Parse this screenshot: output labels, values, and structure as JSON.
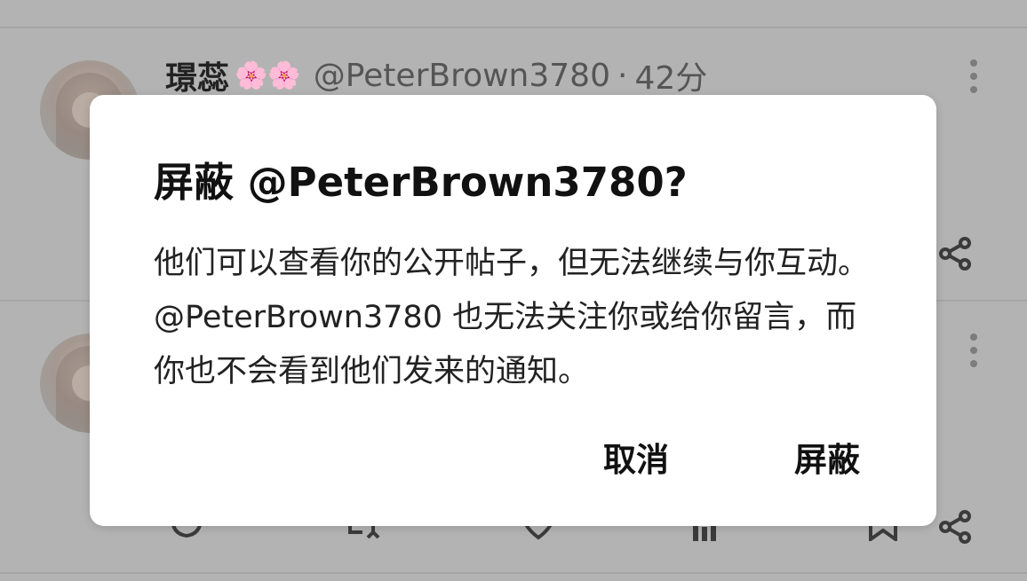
{
  "feed": {
    "tweet": {
      "display_name": "璟蕊",
      "emojis": "🌸🌸",
      "handle": "@PeterBrown3780",
      "separator": "·",
      "time": "42分"
    }
  },
  "dialog": {
    "title": "屏蔽 @PeterBrown3780?",
    "message": "他们可以查看你的公开帖子，但无法继续与你互动。@PeterBrown3780 也无法关注你或给你留言，而你也不会看到他们发来的通知。",
    "cancel_label": "取消",
    "confirm_label": "屏蔽"
  },
  "colors": {
    "overlay": "#b3b3b3",
    "dialog_background": "#ffffff",
    "text": "#111111",
    "secondary_text": "#555555"
  },
  "icons": [
    "more-vertical-icon",
    "share-icon",
    "reply-icon",
    "retweet-icon",
    "like-icon",
    "views-icon",
    "bookmark-icon"
  ]
}
